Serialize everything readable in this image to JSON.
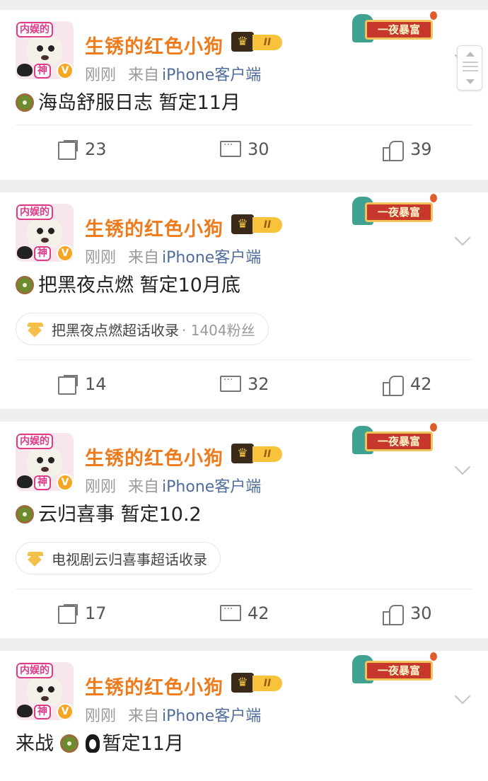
{
  "posts": [
    {
      "author": "生锈的红色小狗",
      "level": "II",
      "time": "刚刚",
      "from_prefix": "来自",
      "source": "iPhone客户端",
      "badge_text": "一夜暴富",
      "content": "海岛舒服日志 暂定11月",
      "topic": null,
      "share_count": "23",
      "comment_count": "30",
      "like_count": "39"
    },
    {
      "author": "生锈的红色小狗",
      "level": "II",
      "time": "刚刚",
      "from_prefix": "来自",
      "source": "iPhone客户端",
      "badge_text": "一夜暴富",
      "content": "把黑夜点燃 暂定10月底",
      "topic": "把黑夜点燃超话收录",
      "topic_fans": "· 1404粉丝",
      "share_count": "14",
      "comment_count": "32",
      "like_count": "42"
    },
    {
      "author": "生锈的红色小狗",
      "level": "II",
      "time": "刚刚",
      "from_prefix": "来自",
      "source": "iPhone客户端",
      "badge_text": "一夜暴富",
      "content": "云归喜事 暂定10.2",
      "topic": "电视剧云归喜事超话收录",
      "share_count": "17",
      "comment_count": "42",
      "like_count": "30"
    },
    {
      "author": "生锈的红色小狗",
      "level": "II",
      "time": "刚刚",
      "from_prefix": "来自",
      "source": "iPhone客户端",
      "badge_text": "一夜暴富",
      "content_before": "来战",
      "content_after": "暂定11月"
    }
  ],
  "avatar": {
    "tag_top": "内娱的",
    "tag_bottom": "神",
    "verified": "V"
  },
  "colors": {
    "name": "#ee7b1c",
    "source": "#506c9d",
    "meta": "#9a9a9a",
    "badge": "#c8372c"
  }
}
